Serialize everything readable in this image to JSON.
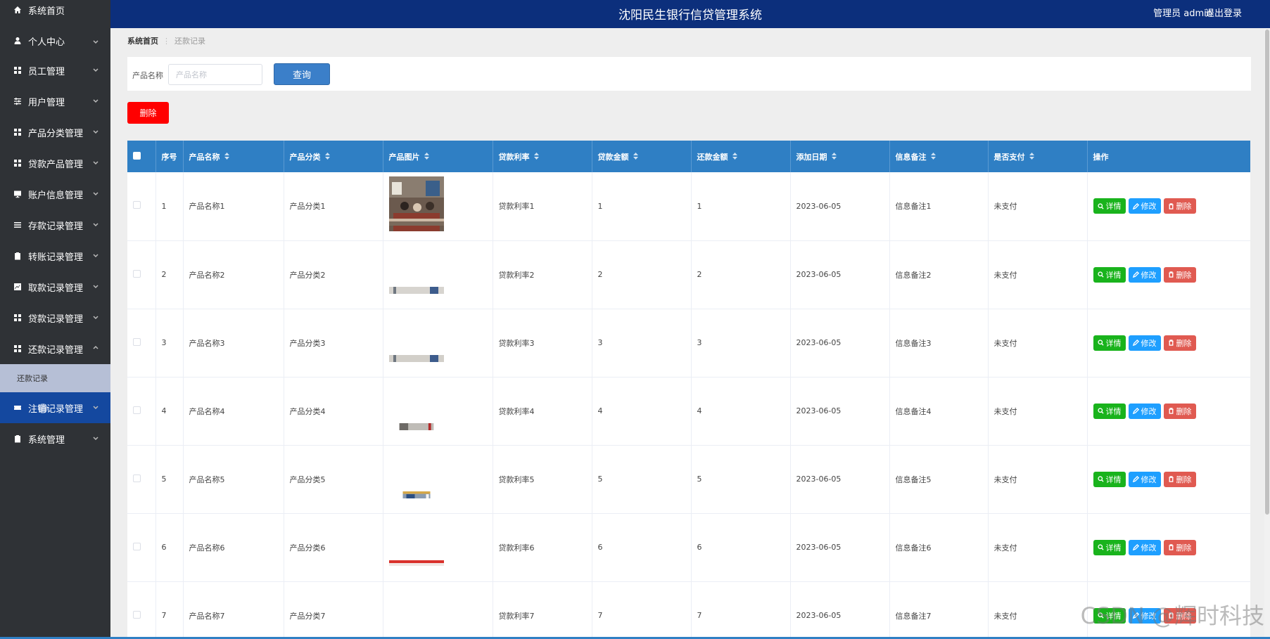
{
  "sidebar": {
    "items": [
      {
        "label": "系统首页",
        "icon": "home-icon",
        "has_chevron": false
      },
      {
        "label": "个人中心",
        "icon": "user-icon",
        "has_chevron": true
      },
      {
        "label": "员工管理",
        "icon": "grid-icon",
        "has_chevron": true
      },
      {
        "label": "用户管理",
        "icon": "sliders-icon",
        "has_chevron": true
      },
      {
        "label": "产品分类管理",
        "icon": "grid-icon",
        "has_chevron": true
      },
      {
        "label": "贷款产品管理",
        "icon": "grid-icon",
        "has_chevron": true
      },
      {
        "label": "账户信息管理",
        "icon": "monitor-icon",
        "has_chevron": true
      },
      {
        "label": "存款记录管理",
        "icon": "list-icon",
        "has_chevron": true
      },
      {
        "label": "转账记录管理",
        "icon": "clipboard-icon",
        "has_chevron": true
      },
      {
        "label": "取款记录管理",
        "icon": "chart-icon",
        "has_chevron": true
      },
      {
        "label": "贷款记录管理",
        "icon": "grid-icon",
        "has_chevron": true
      },
      {
        "label": "还款记录管理",
        "icon": "grid-icon",
        "has_chevron": true,
        "expanded": true
      }
    ],
    "submenu_label": "还款记录",
    "items_after": [
      {
        "label": "注销记录管理",
        "icon": "ticket-icon",
        "has_chevron": true,
        "active": true
      },
      {
        "label": "系统管理",
        "icon": "clipboard-icon",
        "has_chevron": true
      }
    ]
  },
  "header": {
    "title": "沈阳民生银行信贷管理系统",
    "user": "管理员 admin",
    "logout": "退出登录"
  },
  "breadcrumb": {
    "home": "系统首页",
    "current": "还款记录"
  },
  "search": {
    "label": "产品名称",
    "placeholder": "产品名称",
    "button": "查询"
  },
  "delete_button": "删除",
  "table": {
    "columns": [
      "序号",
      "产品名称",
      "产品分类",
      "产品图片",
      "贷款利率",
      "贷款金额",
      "还款金额",
      "添加日期",
      "信息备注",
      "是否支付",
      "操作"
    ],
    "actions": {
      "detail": "详情",
      "edit": "修改",
      "delete": "删除"
    },
    "rows": [
      {
        "no": "1",
        "name": "产品名称1",
        "category": "产品分类1",
        "rate": "贷款利率1",
        "loan": "1",
        "repay": "1",
        "date": "2023-06-05",
        "note": "信息备注1",
        "paid": "未支付"
      },
      {
        "no": "2",
        "name": "产品名称2",
        "category": "产品分类2",
        "rate": "贷款利率2",
        "loan": "2",
        "repay": "2",
        "date": "2023-06-05",
        "note": "信息备注2",
        "paid": "未支付"
      },
      {
        "no": "3",
        "name": "产品名称3",
        "category": "产品分类3",
        "rate": "贷款利率3",
        "loan": "3",
        "repay": "3",
        "date": "2023-06-05",
        "note": "信息备注3",
        "paid": "未支付"
      },
      {
        "no": "4",
        "name": "产品名称4",
        "category": "产品分类4",
        "rate": "贷款利率4",
        "loan": "4",
        "repay": "4",
        "date": "2023-06-05",
        "note": "信息备注4",
        "paid": "未支付"
      },
      {
        "no": "5",
        "name": "产品名称5",
        "category": "产品分类5",
        "rate": "贷款利率5",
        "loan": "5",
        "repay": "5",
        "date": "2023-06-05",
        "note": "信息备注5",
        "paid": "未支付"
      },
      {
        "no": "6",
        "name": "产品名称6",
        "category": "产品分类6",
        "rate": "贷款利率6",
        "loan": "6",
        "repay": "6",
        "date": "2023-06-05",
        "note": "信息备注6",
        "paid": "未支付"
      },
      {
        "no": "7",
        "name": "产品名称7",
        "category": "产品分类7",
        "rate": "贷款利率7",
        "loan": "7",
        "repay": "7",
        "date": "2023-06-05",
        "note": "信息备注7",
        "paid": "未支付"
      }
    ]
  },
  "watermark": "CSDN @辉时科技",
  "colors": {
    "sidebar_bg": "#2f3236",
    "header_bg": "#0c2f7c",
    "table_head": "#2f7fc4",
    "submenu_bg": "#b6bfd6",
    "danger": "#ff0000",
    "detail": "#19b31c",
    "edit": "#1e9fff",
    "delete": "#e05a51"
  }
}
